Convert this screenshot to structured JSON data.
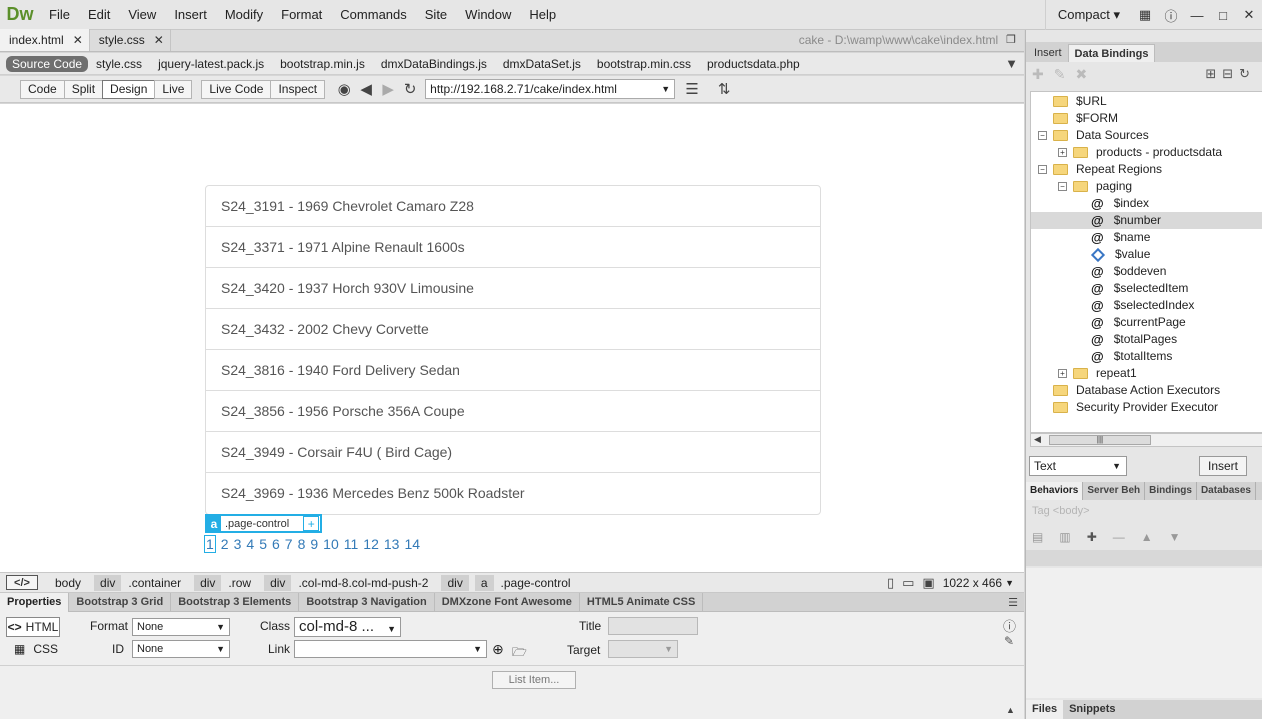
{
  "app": {
    "logo": "Dw",
    "menu": [
      "File",
      "Edit",
      "View",
      "Insert",
      "Modify",
      "Format",
      "Commands",
      "Site",
      "Window",
      "Help"
    ],
    "workspace": "Compact"
  },
  "doc_tabs": [
    {
      "label": "index.html",
      "active": true
    },
    {
      "label": "style.css",
      "active": false
    }
  ],
  "doc_path": "cake - D:\\wamp\\www\\cake\\index.html",
  "related_files": [
    "Source Code",
    "style.css",
    "jquery-latest.pack.js",
    "bootstrap.min.js",
    "dmxDataBindings.js",
    "dmxDataSet.js",
    "bootstrap.min.css",
    "productsdata.php"
  ],
  "view_buttons": [
    "Code",
    "Split",
    "Design",
    "Live"
  ],
  "live_code_label": "Live Code",
  "inspect_label": "Inspect",
  "url": "http://192.168.2.71/cake/index.html",
  "products": [
    "S24_3191 - 1969 Chevrolet Camaro Z28",
    "S24_3371 - 1971 Alpine Renault 1600s",
    "S24_3420 - 1937 Horch 930V Limousine",
    "S24_3432 - 2002 Chevy Corvette",
    "S24_3816 - 1940 Ford Delivery Sedan",
    "S24_3856 - 1956 Porsche 356A Coupe",
    "S24_3949 - Corsair F4U ( Bird Cage)",
    "S24_3969 - 1936 Mercedes Benz 500k Roadster"
  ],
  "element_badge": {
    "tag": "a",
    "class": ".page-control",
    "plus": "+"
  },
  "pages": [
    "1",
    "2",
    "3",
    "4",
    "5",
    "6",
    "7",
    "8",
    "9",
    "10",
    "11",
    "12",
    "13",
    "14"
  ],
  "current_page": "1",
  "tag_selector": {
    "code_label": "</>",
    "crumbs": [
      {
        "label": "body",
        "chip": false
      },
      {
        "label": "div",
        "chip": true
      },
      {
        "label": ".container",
        "chip": false
      },
      {
        "label": "div",
        "chip": true
      },
      {
        "label": ".row",
        "chip": false
      },
      {
        "label": "div",
        "chip": true
      },
      {
        "label": ".col-md-8.col-md-push-2",
        "chip": false
      },
      {
        "label": "div",
        "chip": true
      },
      {
        "label": "a",
        "chip": true
      },
      {
        "label": ".page-control",
        "chip": false
      }
    ],
    "size": "1022 x 466"
  },
  "properties": {
    "tabs": [
      "Properties",
      "Bootstrap 3 Grid",
      "Bootstrap 3 Elements",
      "Bootstrap 3 Navigation",
      "DMXzone Font Awesome",
      "HTML5 Animate CSS"
    ],
    "html_label": "HTML",
    "css_label": "CSS",
    "format_label": "Format",
    "format_value": "None",
    "id_label": "ID",
    "id_value": "None",
    "class_label": "Class",
    "class_value": "col-md-8 ...",
    "link_label": "Link",
    "link_value": "",
    "title_label": "Title",
    "target_label": "Target",
    "list_item_label": "List Item..."
  },
  "right_panel": {
    "top_tabs": [
      "Insert",
      "Data Bindings"
    ],
    "tree": [
      {
        "label": "$URL",
        "kind": "folder",
        "indent": 0
      },
      {
        "label": "$FORM",
        "kind": "folder",
        "indent": 0
      },
      {
        "label": "Data Sources",
        "kind": "folder",
        "indent": 0,
        "expander": "−"
      },
      {
        "label": "products - productsdata",
        "kind": "folder",
        "indent": 1,
        "expander": "+"
      },
      {
        "label": "Repeat Regions",
        "kind": "folder",
        "indent": 0,
        "expander": "−"
      },
      {
        "label": "paging",
        "kind": "folder",
        "indent": 1,
        "expander": "−"
      },
      {
        "label": "$index",
        "kind": "at",
        "indent": 2
      },
      {
        "label": "$number",
        "kind": "at",
        "indent": 2,
        "highlight": true
      },
      {
        "label": "$name",
        "kind": "at",
        "indent": 2
      },
      {
        "label": "$value",
        "kind": "diamond",
        "indent": 2
      },
      {
        "label": "$oddeven",
        "kind": "at",
        "indent": 2
      },
      {
        "label": "$selectedItem",
        "kind": "at",
        "indent": 2
      },
      {
        "label": "$selectedIndex",
        "kind": "at",
        "indent": 2
      },
      {
        "label": "$currentPage",
        "kind": "at",
        "indent": 2
      },
      {
        "label": "$totalPages",
        "kind": "at",
        "indent": 2
      },
      {
        "label": "$totalItems",
        "kind": "at",
        "indent": 2
      },
      {
        "label": "repeat1",
        "kind": "folder",
        "indent": 1,
        "expander": "+"
      },
      {
        "label": "Database Action Executors",
        "kind": "folder",
        "indent": 0
      },
      {
        "label": "Security Provider Executor",
        "kind": "folder",
        "indent": 0
      }
    ],
    "text_select": "Text",
    "insert_button": "Insert",
    "bottom_tabs": [
      "Behaviors",
      "Server Beh",
      "Bindings",
      "Databases"
    ],
    "tag_hint": "Tag <body>",
    "file_tabs": [
      "Files",
      "Snippets"
    ]
  }
}
